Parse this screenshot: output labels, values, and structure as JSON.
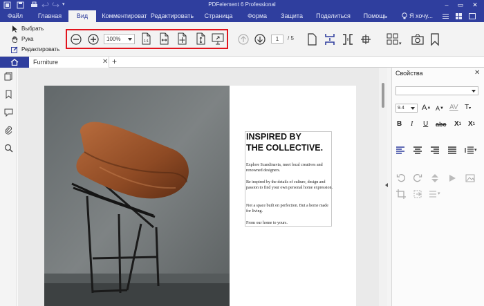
{
  "window": {
    "title": "PDFelement 6 Professional"
  },
  "menu": {
    "file": "Файл",
    "items": [
      "Главная",
      "Вид",
      "Комментироват",
      "Редактировать",
      "Страница",
      "Форма",
      "Защита",
      "Поделиться",
      "Помощь"
    ],
    "active": "Вид",
    "search_placeholder": "Я хочу..."
  },
  "ribbon": {
    "tools": {
      "select": "Выбрать",
      "hand": "Рука",
      "edit": "Редактировать"
    },
    "zoom_value": "100%",
    "page_current": "1",
    "page_total": "/ 5"
  },
  "tabs": {
    "document": "Furniture"
  },
  "properties": {
    "title": "Свойства",
    "font_size": "9.4"
  },
  "document": {
    "heading_line1": "INSPIRED BY",
    "heading_line2": "THE COLLECTIVE.",
    "paragraphs": [
      "Explore Scandinavia, meet local creatives and renowned designers.",
      "Be inspired by the details of culture, design and passion to find your own personal home expression.",
      "Not a space built on perfection. But a home made for living.",
      "From our home to yours."
    ]
  },
  "colors": {
    "brand": "#2f3e9e",
    "highlight_frame": "#e2141d",
    "active_tool": "#2f3e9e"
  }
}
